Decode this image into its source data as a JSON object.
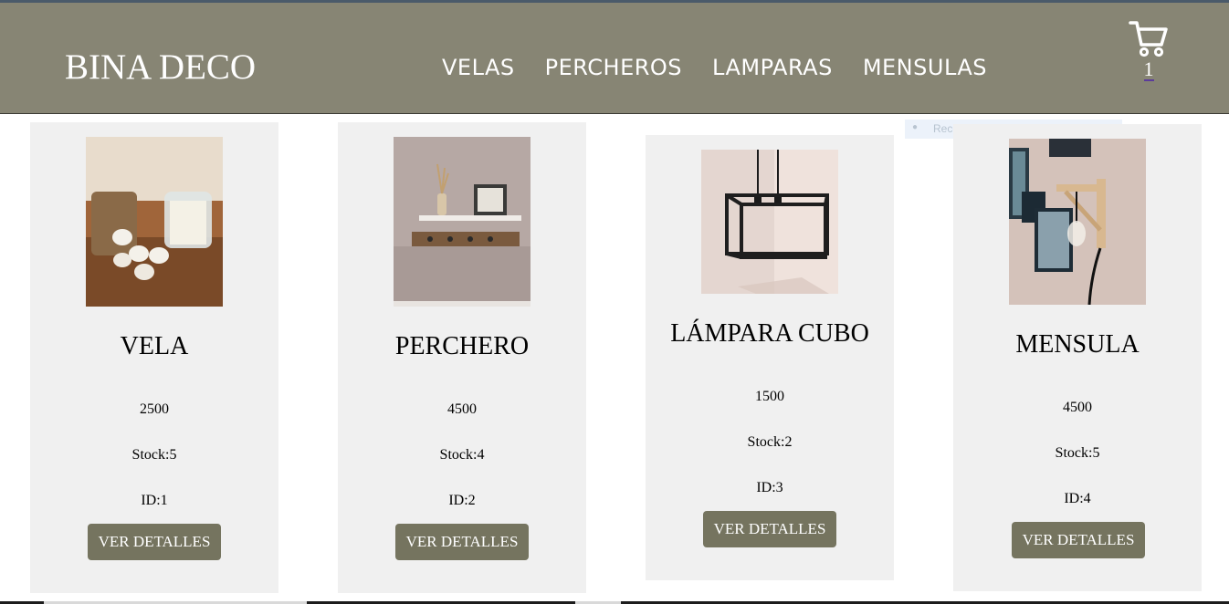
{
  "header": {
    "brand": "BINA DECO",
    "nav": [
      "VELAS",
      "PERCHEROS",
      "LAMPARAS",
      "MENSULAS"
    ],
    "cart_count": "1"
  },
  "overlay": {
    "label": "Recorte rectangular"
  },
  "products": [
    {
      "title": "VELA",
      "price": "2500",
      "stock": "Stock:5",
      "id": "ID:1",
      "button": "VER DETALLES",
      "image": "candles-photo"
    },
    {
      "title": "PERCHERO",
      "price": "4500",
      "stock": "Stock:4",
      "id": "ID:2",
      "button": "VER DETALLES",
      "image": "coat-rack-photo"
    },
    {
      "title": "LÁMPARA CUBO",
      "price": "1500",
      "stock": "Stock:2",
      "id": "ID:3",
      "button": "VER DETALLES",
      "image": "cube-lamp-photo"
    },
    {
      "title": "MENSULA",
      "price": "4500",
      "stock": "Stock:5",
      "id": "ID:4",
      "button": "VER DETALLES",
      "image": "wall-bracket-photo"
    }
  ],
  "colors": {
    "navbar": "#878574",
    "button": "#75745f",
    "card": "#f0f0f0"
  }
}
